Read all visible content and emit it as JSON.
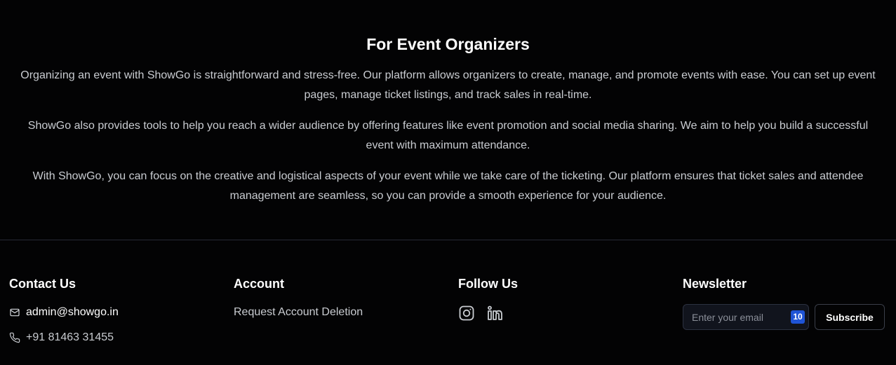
{
  "organizers": {
    "title": "For Event Organizers",
    "paragraphs": [
      "Organizing an event with ShowGo is straightforward and stress-free. Our platform allows organizers to create, manage, and promote events with ease. You can set up event pages, manage ticket listings, and track sales in real-time.",
      "ShowGo also provides tools to help you reach a wider audience by offering features like event promotion and social media sharing. We aim to help you build a successful event with maximum attendance.",
      "With ShowGo, you can focus on the creative and logistical aspects of your event while we take care of the ticketing. Our platform ensures that ticket sales and attendee management are seamless, so you can provide a smooth experience for your audience."
    ]
  },
  "footer": {
    "contact": {
      "heading": "Contact Us",
      "email": "admin@showgo.in",
      "phone": "+91 81463 31455",
      "email_icon": "mail-icon",
      "phone_icon": "phone-icon"
    },
    "account": {
      "heading": "Account",
      "delete_link": "Request Account Deletion"
    },
    "follow": {
      "heading": "Follow Us",
      "icons": [
        "instagram-icon",
        "linkedin-icon"
      ]
    },
    "newsletter": {
      "heading": "Newsletter",
      "placeholder": "Enter your email",
      "badge": "10",
      "button_label": "Subscribe"
    }
  },
  "colors": {
    "background": "#030304",
    "text_primary": "#ffffff",
    "text_secondary": "#c9ccd1",
    "divider": "#262a36",
    "badge": "#1f54d6"
  }
}
